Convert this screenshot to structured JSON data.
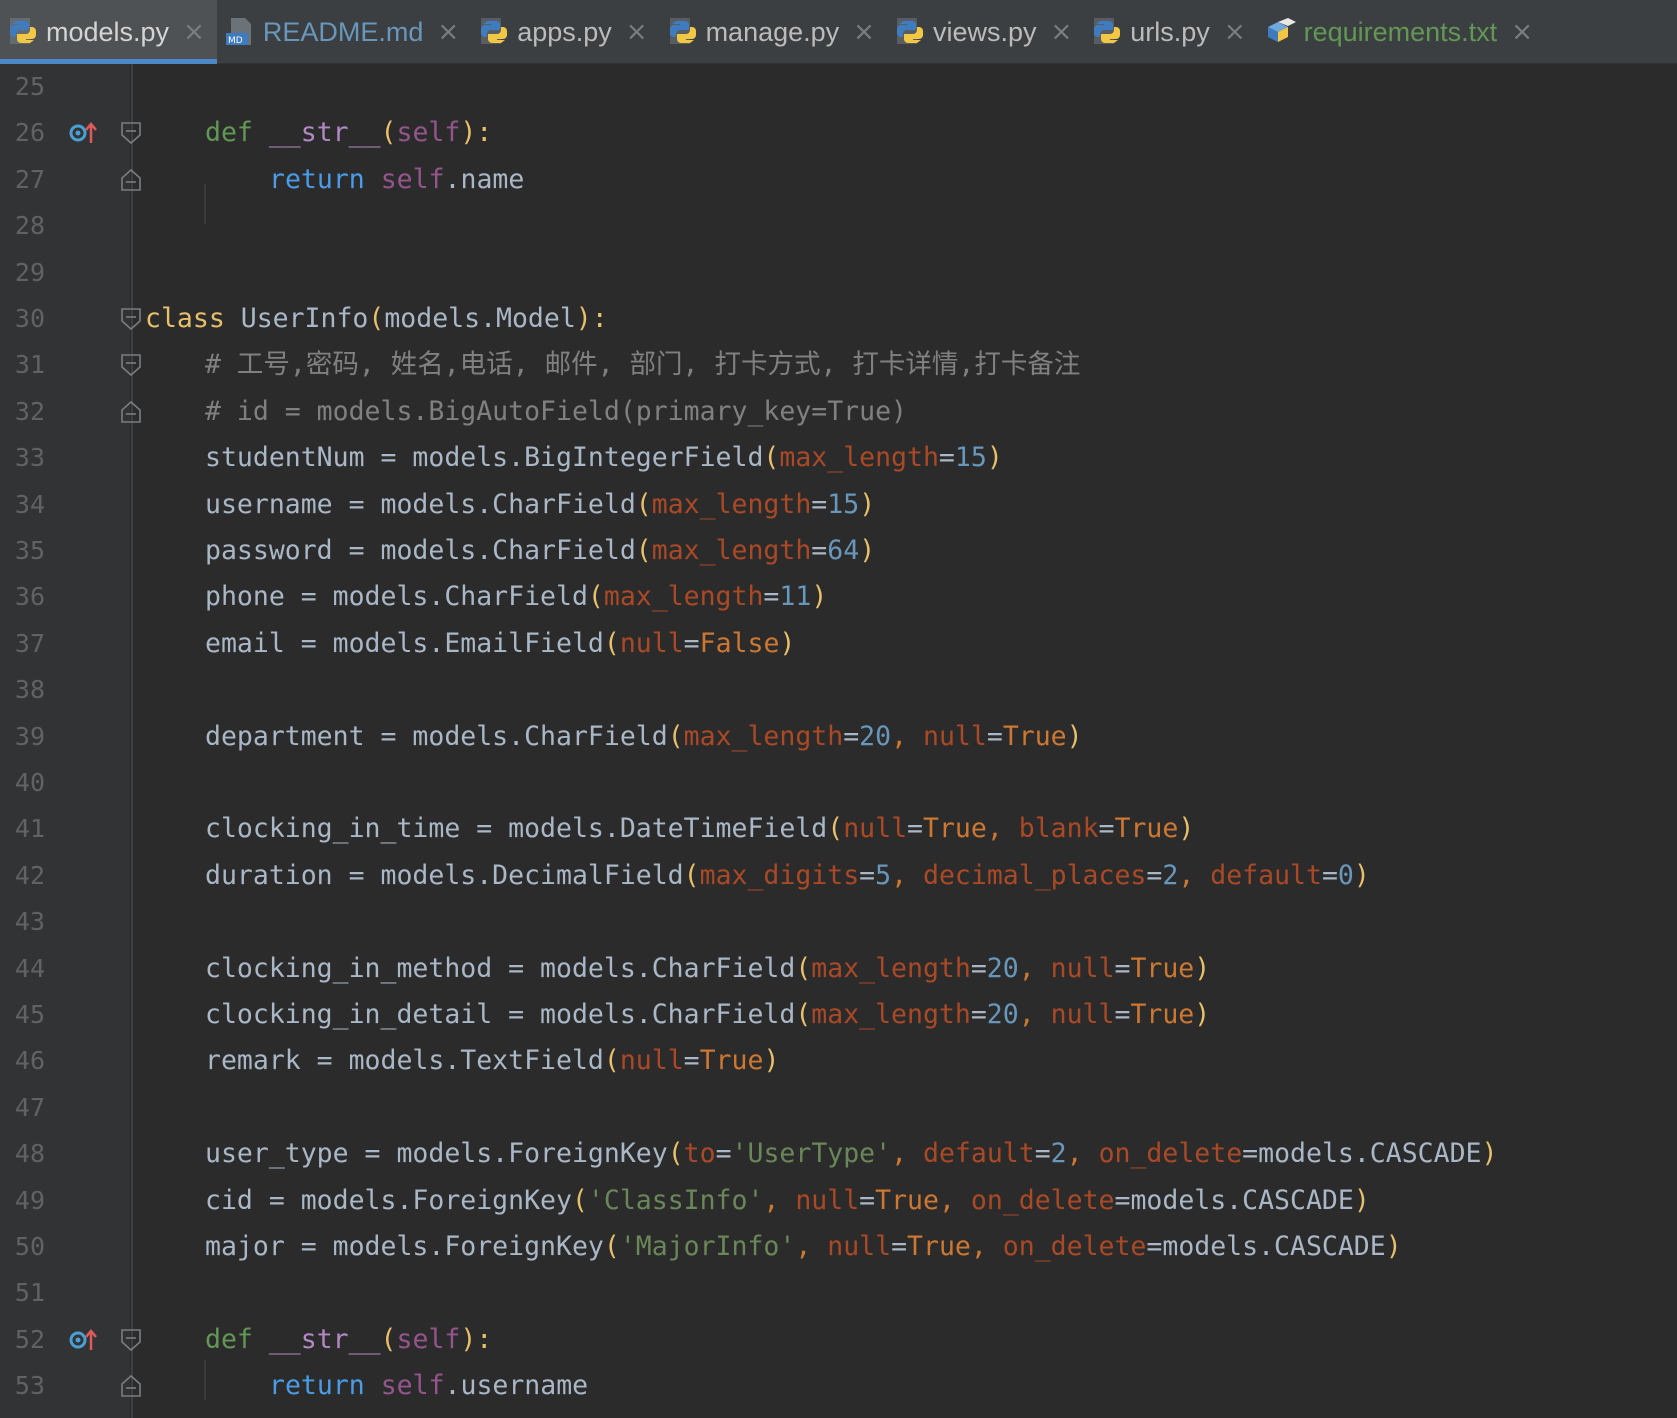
{
  "tabs": [
    {
      "label": "models.py",
      "icon": "python-file-icon",
      "active": true
    },
    {
      "label": "README.md",
      "icon": "markdown-file-icon",
      "active": false
    },
    {
      "label": "apps.py",
      "icon": "python-file-icon",
      "active": false
    },
    {
      "label": "manage.py",
      "icon": "python-file-icon",
      "active": false
    },
    {
      "label": "views.py",
      "icon": "python-file-icon",
      "active": false
    },
    {
      "label": "urls.py",
      "icon": "python-file-icon",
      "active": false
    },
    {
      "label": "requirements.txt",
      "icon": "requirements-file-icon",
      "active": false
    }
  ],
  "tab_close_glyph": "×",
  "line_numbers": [
    "25",
    "26",
    "27",
    "28",
    "29",
    "30",
    "31",
    "32",
    "33",
    "34",
    "35",
    "36",
    "37",
    "38",
    "39",
    "40",
    "41",
    "42",
    "43",
    "44",
    "45",
    "46",
    "47",
    "48",
    "49",
    "50",
    "51",
    "52",
    "53"
  ],
  "code": {
    "l26": {
      "def": "def",
      "name": "__str__",
      "open": "(",
      "self": "self",
      "close": "):"
    },
    "l27": {
      "ret": "return",
      "self": "self",
      "rest": ".name"
    },
    "l30": {
      "class": "class",
      "name": " UserInfo",
      "open": "(",
      "base": "models.Model",
      "close": "):"
    },
    "l31": {
      "comment": "# 工号,密码, 姓名,电话, 邮件, 部门, 打卡方式, 打卡详情,打卡备注"
    },
    "l32": {
      "comment": "# id = models.BigAutoField(primary_key=True)"
    },
    "l33": {
      "lhs": "studentNum = models.BigIntegerField",
      "p1": "max_length",
      "v1": "15"
    },
    "l34": {
      "lhs": "username = models.CharField",
      "p1": "max_length",
      "v1": "15"
    },
    "l35": {
      "lhs": "password = models.CharField",
      "p1": "max_length",
      "v1": "64"
    },
    "l36": {
      "lhs": "phone = models.CharField",
      "p1": "max_length",
      "v1": "11"
    },
    "l37": {
      "lhs": "email = models.EmailField",
      "p1": "null",
      "v1": "False"
    },
    "l39": {
      "lhs": "department = models.CharField",
      "p1": "max_length",
      "v1": "20",
      "p2": "null",
      "v2": "True"
    },
    "l41": {
      "lhs": "clocking_in_time = models.DateTimeField",
      "p1": "null",
      "v1": "True",
      "p2": "blank",
      "v2": "True"
    },
    "l42": {
      "lhs": "duration = models.DecimalField",
      "p1": "max_digits",
      "v1": "5",
      "p2": "decimal_places",
      "v2": "2",
      "p3": "default",
      "v3": "0"
    },
    "l44": {
      "lhs": "clocking_in_method = models.CharField",
      "p1": "max_length",
      "v1": "20",
      "p2": "null",
      "v2": "True"
    },
    "l45": {
      "lhs": "clocking_in_detail = models.CharField",
      "p1": "max_length",
      "v1": "20",
      "p2": "null",
      "v2": "True"
    },
    "l46": {
      "lhs": "remark = models.TextField",
      "p1": "null",
      "v1": "True"
    },
    "l48": {
      "lhs": "user_type = models.ForeignKey",
      "p1": "to",
      "s1": "'UserType'",
      "p2": "default",
      "v2": "2",
      "p3": "on_delete",
      "v3": "models.CASCADE"
    },
    "l49": {
      "lhs": "cid = models.ForeignKey",
      "s1": "'ClassInfo'",
      "p2": "null",
      "v2": "True",
      "p3": "on_delete",
      "v3": "models.CASCADE"
    },
    "l50": {
      "lhs": "major = models.ForeignKey",
      "s1": "'MajorInfo'",
      "p2": "null",
      "v2": "True",
      "p3": "on_delete",
      "v3": "models.CASCADE"
    },
    "l52": {
      "def": "def",
      "name": "__str__",
      "open": "(",
      "self": "self",
      "close": "):"
    },
    "l53": {
      "ret": "return",
      "self": "self",
      "rest": ".username"
    }
  },
  "colors": {
    "background": "#2b2b2b",
    "gutter": "#313335",
    "tabbar": "#3c3f41",
    "active_tab_underline": "#4a88c7",
    "override_marker": "#4aa0d4"
  }
}
